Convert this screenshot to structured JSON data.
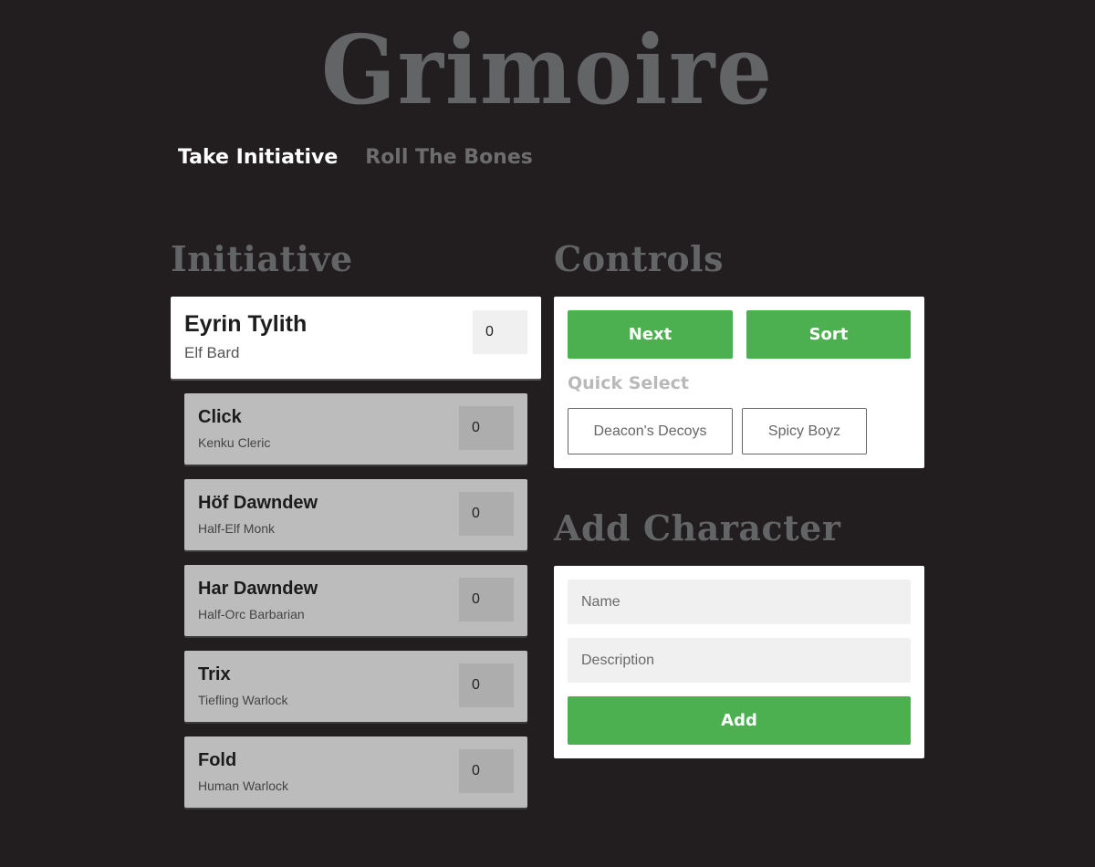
{
  "app": {
    "logo_text": "Grimoire"
  },
  "nav": {
    "tabs": [
      {
        "label": "Take Initiative",
        "active": true
      },
      {
        "label": "Roll The Bones",
        "active": false
      }
    ]
  },
  "initiative": {
    "heading": "Initiative",
    "current": {
      "name": "Eyrin Tylith",
      "description": "Elf Bard",
      "score": "0"
    },
    "queue": [
      {
        "name": "Click",
        "description": "Kenku Cleric",
        "score": "0"
      },
      {
        "name": "Höf Dawndew",
        "description": "Half-Elf Monk",
        "score": "0"
      },
      {
        "name": "Har Dawndew",
        "description": "Half-Orc Barbarian",
        "score": "0"
      },
      {
        "name": "Trix",
        "description": "Tiefling Warlock",
        "score": "0"
      },
      {
        "name": "Fold",
        "description": "Human Warlock",
        "score": "0"
      }
    ]
  },
  "controls": {
    "heading": "Controls",
    "next_label": "Next",
    "sort_label": "Sort",
    "quick_select_label": "Quick Select",
    "quick_select": [
      "Deacon's Decoys",
      "Spicy Boyz"
    ]
  },
  "add_character": {
    "heading": "Add Character",
    "name_placeholder": "Name",
    "description_placeholder": "Description",
    "add_label": "Add"
  },
  "colors": {
    "background": "#221e1f",
    "accent_green": "#4caf50",
    "heading_gray": "#626466"
  }
}
